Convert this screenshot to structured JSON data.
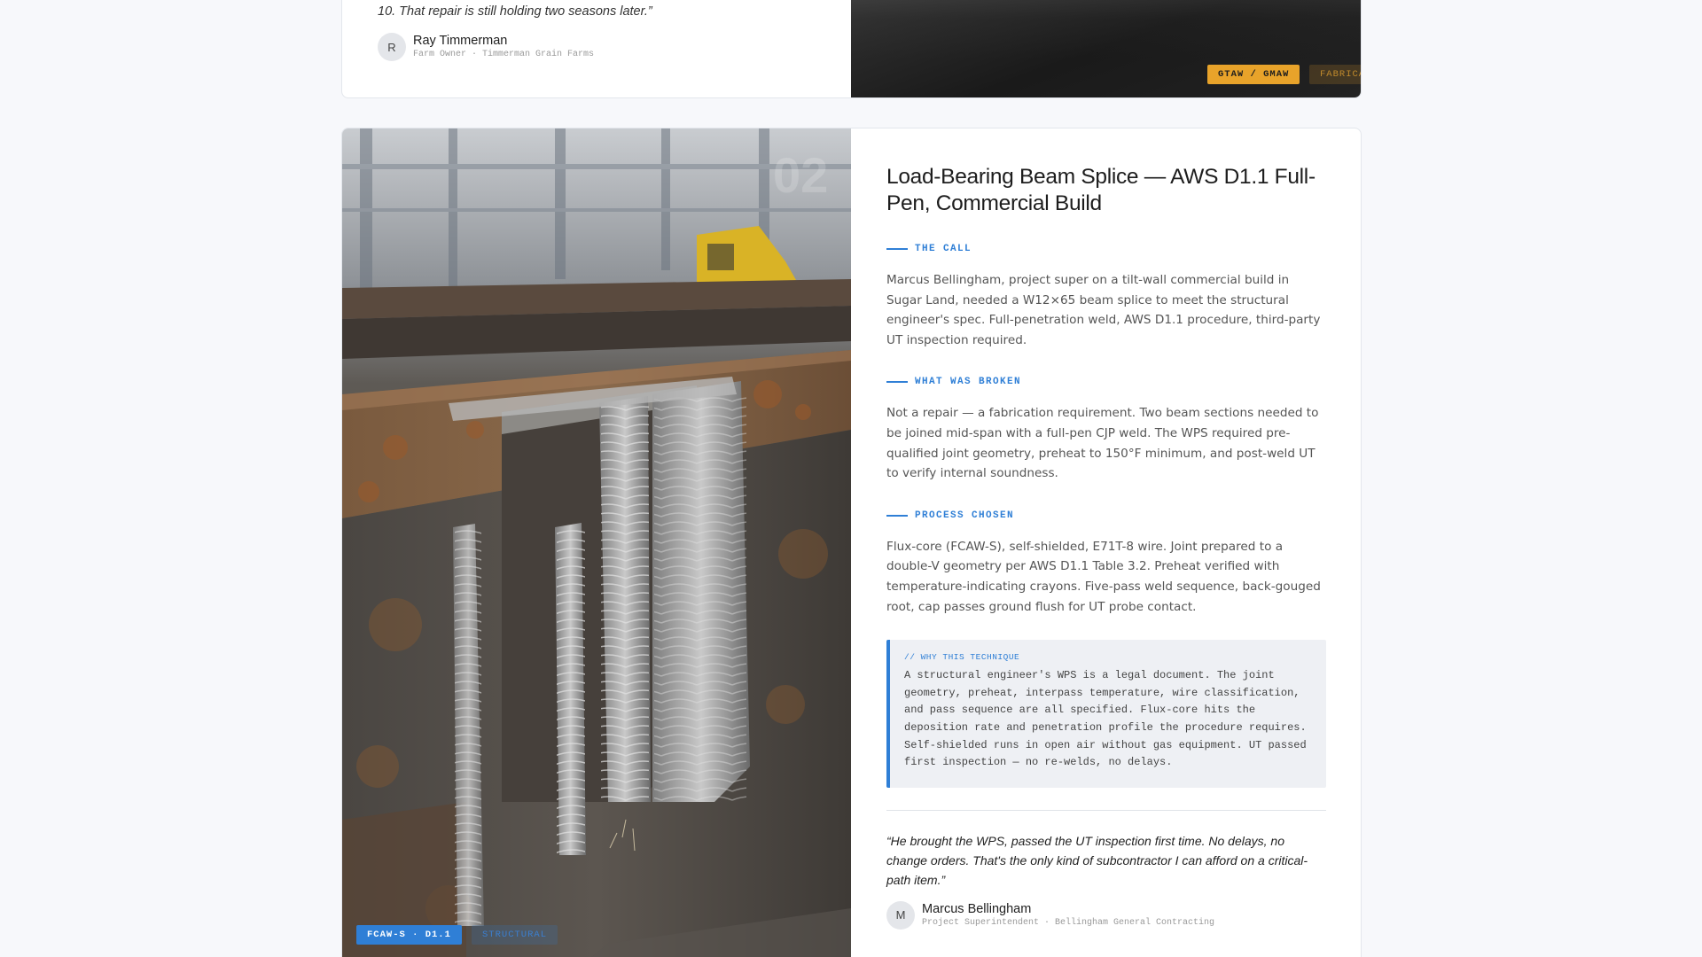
{
  "prev_card": {
    "quote_tail": "10. That repair is still holding two seasons later.”",
    "author": {
      "initial": "R",
      "name": "Ray Timmerman",
      "role": "Farm Owner · Timmerman Grain Farms"
    },
    "tags": [
      "GTAW / GMAW",
      "FABRICATION"
    ]
  },
  "card": {
    "number": "02",
    "title": "Load-Bearing Beam Splice — AWS D1.1 Full-Pen, Commercial Build",
    "sections": [
      {
        "label": "THE CALL",
        "text": "Marcus Bellingham, project super on a tilt-wall commercial build in Sugar Land, needed a W12×65 beam splice to meet the structural engineer's spec. Full-penetration weld, AWS D1.1 procedure, third-party UT inspection required."
      },
      {
        "label": "WHAT WAS BROKEN",
        "text": "Not a repair — a fabrication requirement. Two beam sections needed to be joined mid-span with a full-pen CJP weld. The WPS required pre-qualified joint geometry, preheat to 150°F minimum, and post-weld UT to verify internal soundness."
      },
      {
        "label": "PROCESS CHOSEN",
        "text": "Flux-core (FCAW-S), self-shielded, E71T-8 wire. Joint prepared to a double-V geometry per AWS D1.1 Table 3.2. Preheat verified with temperature-indicating crayons. Five-pass weld sequence, back-gouged root, cap passes ground flush for UT probe contact."
      }
    ],
    "why": {
      "label": "// WHY THIS TECHNIQUE",
      "text": "A structural engineer's WPS is a legal document. The joint geometry, preheat, interpass temperature, wire classification, and pass sequence are all specified. Flux-core hits the deposition rate and penetration profile the procedure requires. Self-shielded runs in open air without gas equipment. UT passed first inspection — no re-welds, no delays."
    },
    "quote": "“He brought the WPS, passed the UT inspection first time. No delays, no change orders. That's the only kind of subcontractor I can afford on a critical-path item.”",
    "author": {
      "initial": "M",
      "name": "Marcus Bellingham",
      "role": "Project Superintendent · Bellingham General Contracting"
    },
    "tags": [
      "FCAW-S · D1.1",
      "STRUCTURAL"
    ]
  },
  "colors": {
    "accent_blue": "#2f7fd6",
    "accent_gold": "#e8a32a"
  },
  "image": {
    "description_icon": "welded-beam-photo"
  }
}
